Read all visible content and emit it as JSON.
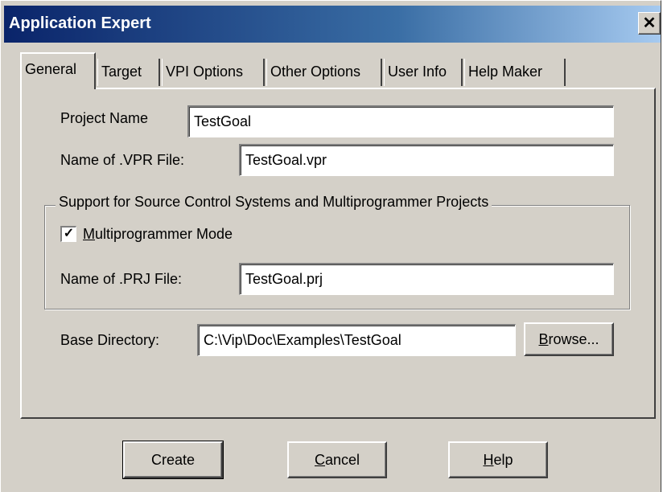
{
  "window": {
    "title": "Application Expert",
    "close_glyph": "✕"
  },
  "tabs": [
    {
      "label": "General",
      "active": true
    },
    {
      "label": "Target",
      "active": false
    },
    {
      "label": "VPI Options",
      "active": false
    },
    {
      "label": "Other Options",
      "active": false
    },
    {
      "label": "User Info",
      "active": false
    },
    {
      "label": "Help Maker",
      "active": false
    }
  ],
  "general": {
    "project_name_label": "Project Name",
    "project_name_value": "TestGoal",
    "vpr_label": "Name of .VPR File:",
    "vpr_value": "TestGoal.vpr",
    "group_title": "Support for Source Control Systems and Multiprogrammer Projects",
    "multiprogrammer": {
      "checked": true,
      "check_glyph": "✓",
      "label_first": "M",
      "label_rest": "ultiprogrammer Mode"
    },
    "prj_label": "Name of .PRJ File:",
    "prj_value": "TestGoal.prj",
    "base_dir_label": "Base Directory:",
    "base_dir_value": "C:\\Vip\\Doc\\Examples\\TestGoal",
    "browse": {
      "first": "B",
      "rest": "rowse..."
    }
  },
  "buttons": {
    "create": "Create",
    "cancel": {
      "first": "C",
      "rest": "ancel"
    },
    "help": {
      "first": "H",
      "rest": "elp"
    }
  },
  "colors": {
    "titlebar_start": "#0a246a",
    "titlebar_end": "#a6caf0",
    "face": "#d4d0c8"
  },
  "icons": {
    "close": "close-icon",
    "check": "checkmark-icon"
  }
}
